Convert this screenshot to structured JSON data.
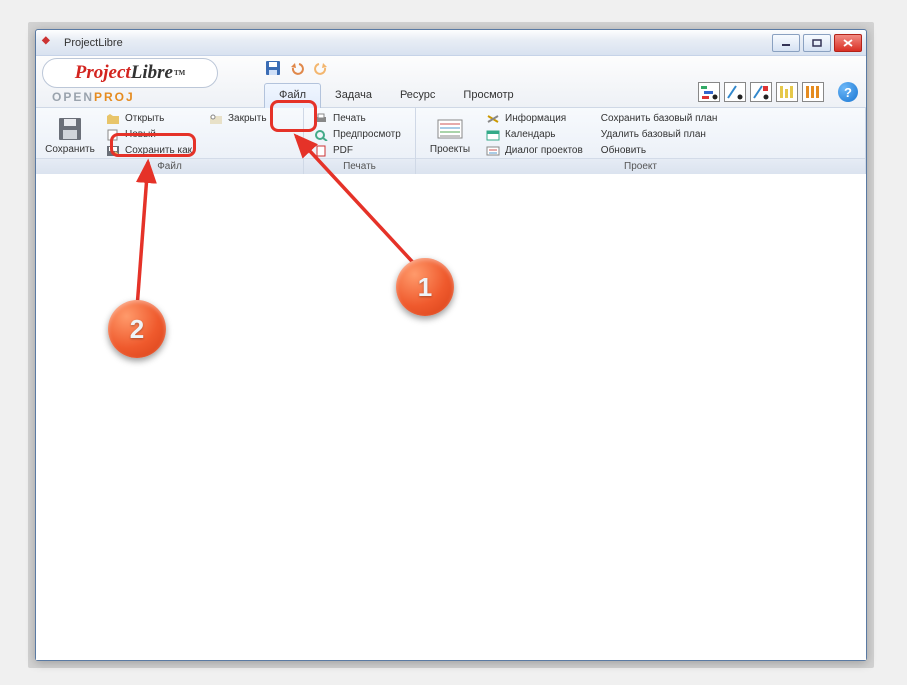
{
  "window": {
    "title": "ProjectLibre"
  },
  "logo": {
    "prefix": "Project",
    "suffix": "Libre",
    "tm": "TM",
    "subtitle_a": "OPEN",
    "subtitle_b": "PROJ"
  },
  "tabs": {
    "file": "Файл",
    "task": "Задача",
    "resource": "Ресурс",
    "view": "Просмотр"
  },
  "quick": {
    "save": "save-icon",
    "undo": "undo-icon",
    "redo": "redo-icon"
  },
  "ribbon": {
    "file": {
      "save": "Сохранить",
      "open": "Открыть",
      "new": "Новый",
      "save_as": "Сохранить как",
      "close": "Закрыть",
      "group_label": "Файл"
    },
    "print": {
      "print": "Печать",
      "preview": "Предпросмотр",
      "pdf": "PDF",
      "group_label": "Печать"
    },
    "project": {
      "projects": "Проекты",
      "info": "Информация",
      "calendar": "Календарь",
      "dialog": "Диалог проектов",
      "save_baseline": "Сохранить базовый план",
      "delete_baseline": "Удалить базовый план",
      "update": "Обновить",
      "group_label": "Проект"
    }
  },
  "help": {
    "symbol": "?"
  },
  "annotations": {
    "b1": "1",
    "b2": "2"
  }
}
